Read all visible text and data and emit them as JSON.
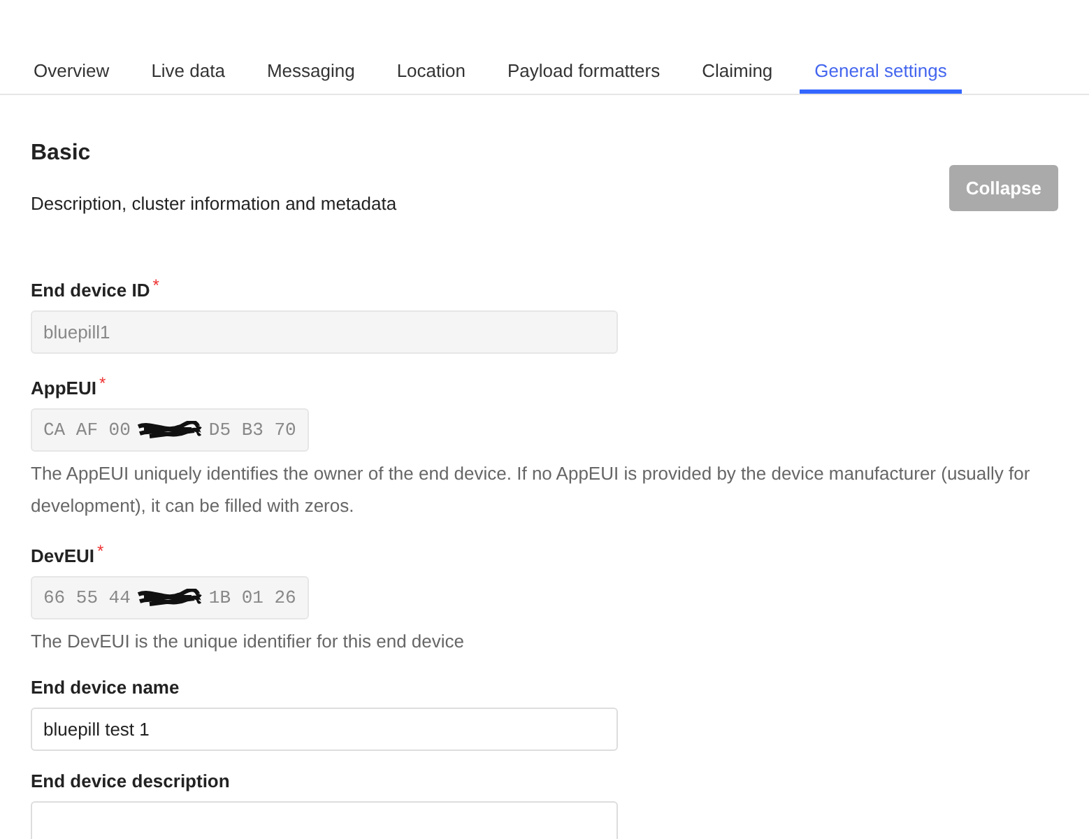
{
  "tabs": [
    {
      "label": "Overview",
      "selected": false
    },
    {
      "label": "Live data",
      "selected": false
    },
    {
      "label": "Messaging",
      "selected": false
    },
    {
      "label": "Location",
      "selected": false
    },
    {
      "label": "Payload formatters",
      "selected": false
    },
    {
      "label": "Claiming",
      "selected": false
    },
    {
      "label": "General settings",
      "selected": true
    }
  ],
  "section": {
    "title": "Basic",
    "description": "Description, cluster information and metadata",
    "collapse_button": "Collapse"
  },
  "fields": [
    {
      "kind": "text",
      "label": "End device ID",
      "required_mark": "*",
      "value": "bluepill1",
      "disabled": true
    },
    {
      "kind": "hex",
      "label": "AppEUI",
      "required_mark": "*",
      "value_before": "CA AF 00",
      "value_after": "D5 B3 70",
      "disabled": true,
      "help": "The AppEUI uniquely identifies the owner of the end device. If no AppEUI is provided by the device manufacturer (usually for development), it can be filled with zeros."
    },
    {
      "kind": "hex",
      "label": "DevEUI",
      "required_mark": "*",
      "value_before": "66 55 44",
      "value_after": "1B 01 26",
      "disabled": true,
      "help": "The DevEUI is the unique identifier for this end device"
    },
    {
      "kind": "text",
      "label": "End device name",
      "value": "bluepill test 1",
      "disabled": false
    },
    {
      "kind": "text",
      "label": "End device description"
    }
  ]
}
